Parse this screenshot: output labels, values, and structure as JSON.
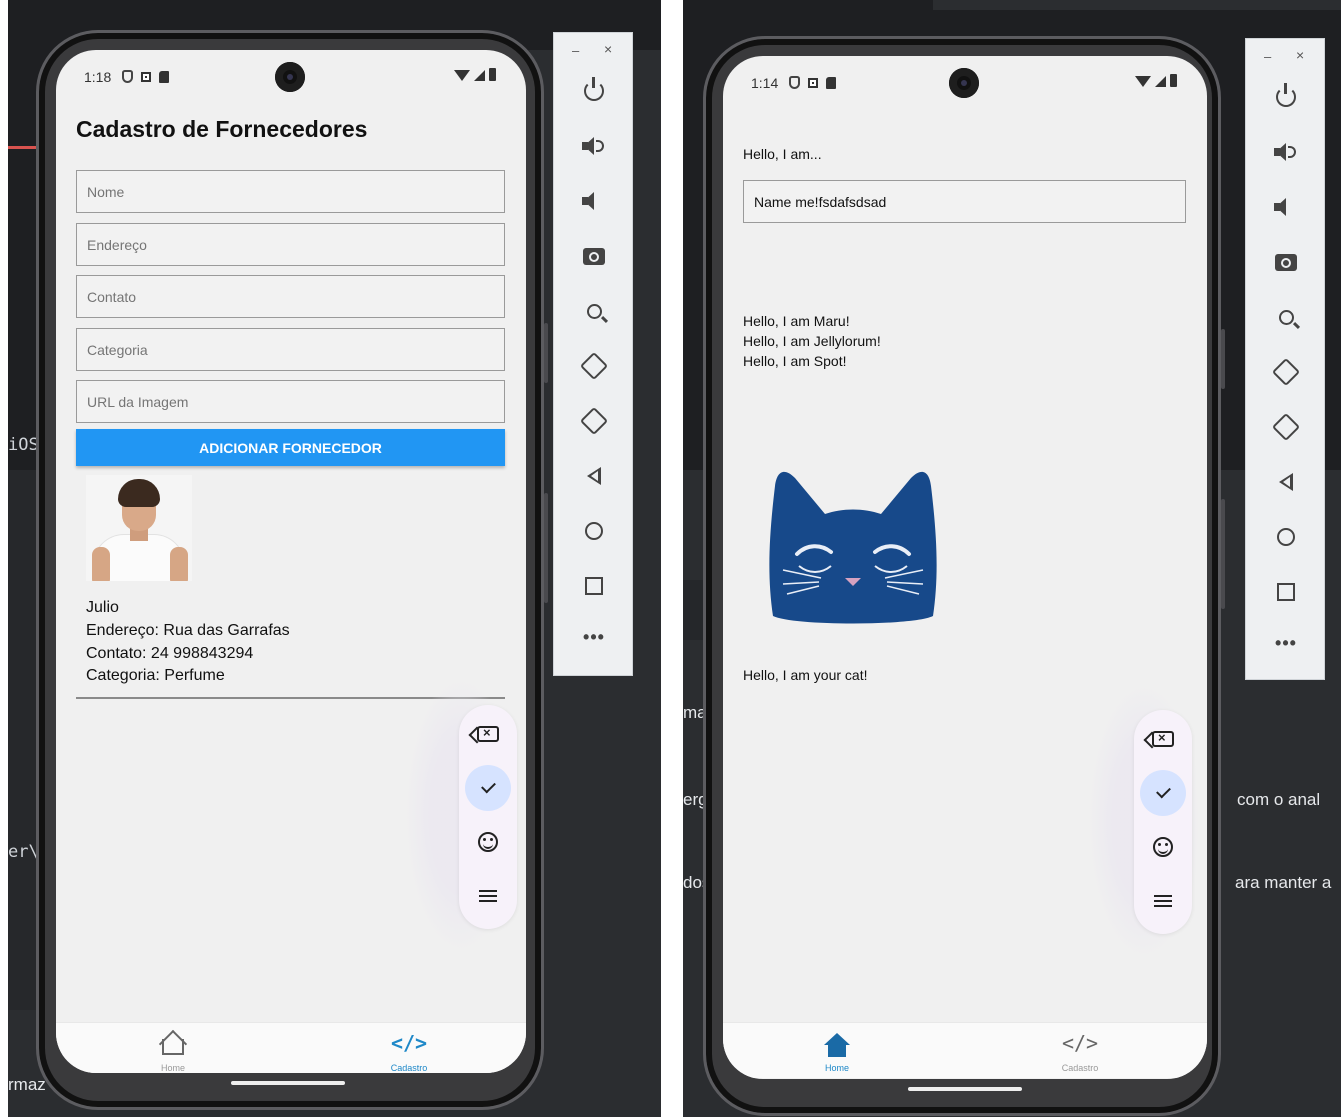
{
  "left": {
    "background": {
      "text_ios": "iOS",
      "text_er": "er\\",
      "text_maz": "rmaz"
    },
    "status": {
      "time": "1:18"
    },
    "form": {
      "title": "Cadastro de Fornecedores",
      "nome_placeholder": "Nome",
      "endereco_placeholder": "Endereço",
      "contato_placeholder": "Contato",
      "categoria_placeholder": "Categoria",
      "url_placeholder": "URL da Imagem",
      "submit_label": "ADICIONAR FORNECEDOR"
    },
    "supplier": {
      "name": "Julio",
      "address": "Endereço: Rua das Garrafas",
      "contact": "Contato: 24 998843294",
      "category": "Categoria: Perfume"
    },
    "nav": {
      "home_label": "Home",
      "cadastro_label": "Cadastro",
      "code_glyph": "</>",
      "active": "Cadastro"
    }
  },
  "right": {
    "background": {
      "text_ma": "ma",
      "text_erg": "erg",
      "text_dos": "dos",
      "text_com_o_anal": "com o anal",
      "text_ara_manter": "ara manter a"
    },
    "status": {
      "time": "1:14"
    },
    "greeting_label": "Hello, I am...",
    "name_input_value": "Name me!fsdafsdsad",
    "cats": [
      "Hello, I am Maru!",
      "Hello, I am Jellylorum!",
      "Hello, I am Spot!"
    ],
    "cat_caption": "Hello, I am your cat!",
    "nav": {
      "home_label": "Home",
      "cadastro_label": "Cadastro",
      "code_glyph": "</>",
      "active": "Home"
    }
  },
  "keyboard_toolbar": {
    "backspace_glyph": "×",
    "active_item": "check"
  },
  "emulator_toolbar": {
    "minimize": "–",
    "close": "×",
    "more": "•••"
  },
  "colors": {
    "primary_button": "#2196f3",
    "active_nav": "#1e88c8",
    "cat_blue": "#17498a",
    "ide_background": "#2b2d30"
  }
}
